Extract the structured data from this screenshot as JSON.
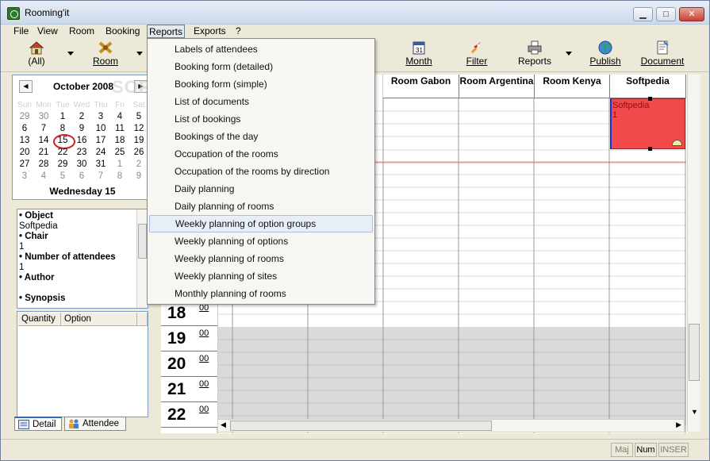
{
  "window": {
    "title": "Rooming'it"
  },
  "menu": [
    "File",
    "View",
    "Room",
    "Booking",
    "Reports",
    "Exports",
    "?"
  ],
  "toolbar": {
    "all": "(All)",
    "room": "Room",
    "month": "Month",
    "filter": "Filter",
    "reports": "Reports",
    "publish": "Publish",
    "document": "Document"
  },
  "calendar": {
    "month": "October 2008",
    "headers": [
      "Sun",
      "Mon",
      "Tue",
      "Wed",
      "Thu",
      "Fri",
      "Sat"
    ],
    "weeks": [
      [
        "29",
        "30",
        "1",
        "2",
        "3",
        "4",
        "5"
      ],
      [
        "6",
        "7",
        "8",
        "9",
        "10",
        "11",
        "12"
      ],
      [
        "13",
        "14",
        "15",
        "16",
        "17",
        "18",
        "19"
      ],
      [
        "20",
        "21",
        "22",
        "23",
        "24",
        "25",
        "26"
      ],
      [
        "27",
        "28",
        "29",
        "30",
        "31",
        "1",
        "2"
      ],
      [
        "3",
        "4",
        "5",
        "6",
        "7",
        "8",
        "9"
      ]
    ],
    "selected": "Wednesday 15"
  },
  "details": {
    "object_label": "• Object",
    "object_value": "Softpedia",
    "chair_label": "• Chair",
    "chair_value": "1",
    "attendees_label": "• Number of attendees",
    "attendees_value": "1",
    "author_label": "• Author",
    "author_value": "",
    "synopsis_label": "• Synopsis"
  },
  "options_table": {
    "quantity": "Quantity",
    "option": "Option"
  },
  "tabs": {
    "detail": "Detail",
    "attendee": "Attendee"
  },
  "schedule": {
    "columns": [
      "Room Gabon",
      "Room Argentina",
      "Room Kenya",
      "Softpedia"
    ],
    "hours": [
      "18",
      "19",
      "20",
      "21",
      "22"
    ],
    "minutes": "00",
    "booking": {
      "title": "Softpedia",
      "count": "1"
    }
  },
  "reports_menu": [
    "Labels of attendees",
    "Booking form (detailed)",
    "Booking form (simple)",
    "List of documents",
    "List of bookings",
    "Bookings of the day",
    "Occupation of the rooms",
    "Occupation of the rooms by direction",
    "Daily planning",
    "Daily planning of rooms",
    "Weekly planning of option groups",
    "Weekly planning of options",
    "Weekly planning of rooms",
    "Weekly planning of sites",
    "Monthly planning of rooms"
  ],
  "statusbar": {
    "maj": "Maj",
    "num": "Num",
    "inser": "INSER"
  },
  "watermark": "SOFTPEDIA"
}
